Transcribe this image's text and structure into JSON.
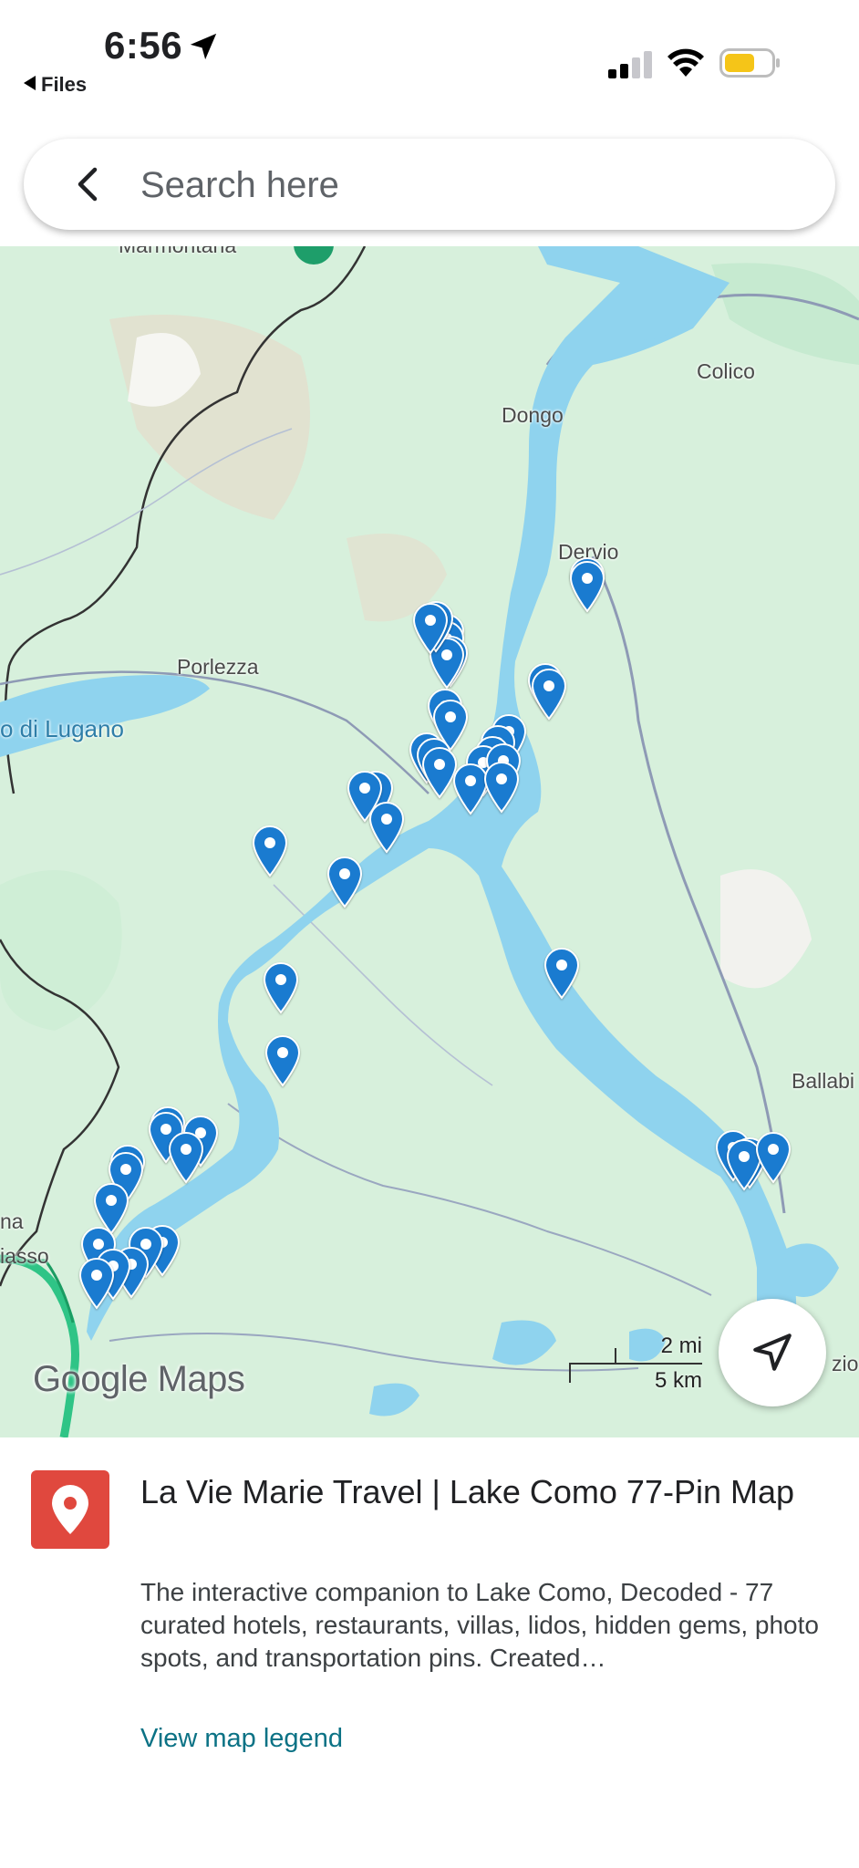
{
  "status_bar": {
    "time": "6:56",
    "back_label": "Files",
    "icons": [
      "location-arrow-icon",
      "cellular-signal-icon",
      "wifi-icon",
      "battery-icon"
    ],
    "battery_color": "#f5c518"
  },
  "search": {
    "placeholder": "Search here",
    "back_icon": "chevron-left-icon"
  },
  "map": {
    "labels": {
      "marmontana": "Marmontana",
      "colico": "Colico",
      "dongo": "Dongo",
      "dervio": "Dervio",
      "porlezza": "Porlezza",
      "lugano": "o di Lugano",
      "ballabio": "Ballabi",
      "chiasso_na": "na",
      "chiasso": "iasso",
      "lecco_edge": "zio"
    },
    "attribution": "Google Maps",
    "scale": {
      "imperial": "2 mi",
      "metric": "5 km"
    },
    "pin_count_visible": 77,
    "pin_color": "#1a7bd0",
    "water_color": "#8fd3ee",
    "land_color": "#d7f0dc"
  },
  "sheet": {
    "title": "La Vie Marie Travel | Lake Como 77-Pin Map",
    "description": "The interactive companion to Lake Como, Decoded - 77 curated hotels, restaurants, villas, lidos, hidden gems, photo spots, and transportation pins. Created…",
    "legend_link": "View map legend",
    "logo_color": "#e0483e"
  }
}
